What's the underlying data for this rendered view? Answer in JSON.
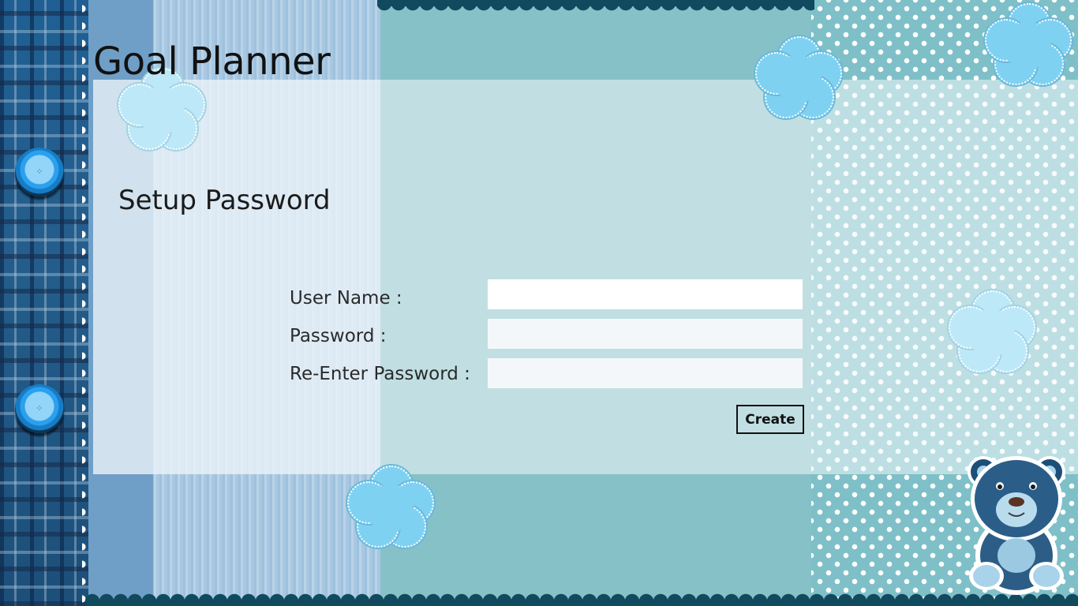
{
  "app": {
    "title": "Goal Planner"
  },
  "page": {
    "title": "Setup Password"
  },
  "form": {
    "username": {
      "label": "User Name :",
      "value": ""
    },
    "password": {
      "label": "Password :",
      "value": ""
    },
    "reenter_password": {
      "label": "Re-Enter Password :",
      "value": ""
    },
    "create_label": "Create"
  },
  "decor": {
    "buttons": [
      "sewing-button-icon",
      "sewing-button-icon"
    ],
    "flowers": [
      "flower-icon"
    ],
    "mascot": "teddy-bear-icon"
  },
  "colors": {
    "teal": "#87c1c8",
    "plaid_blue": "#1f5f93",
    "scallop": "#114a5e",
    "flower": "#7fd1f2"
  }
}
